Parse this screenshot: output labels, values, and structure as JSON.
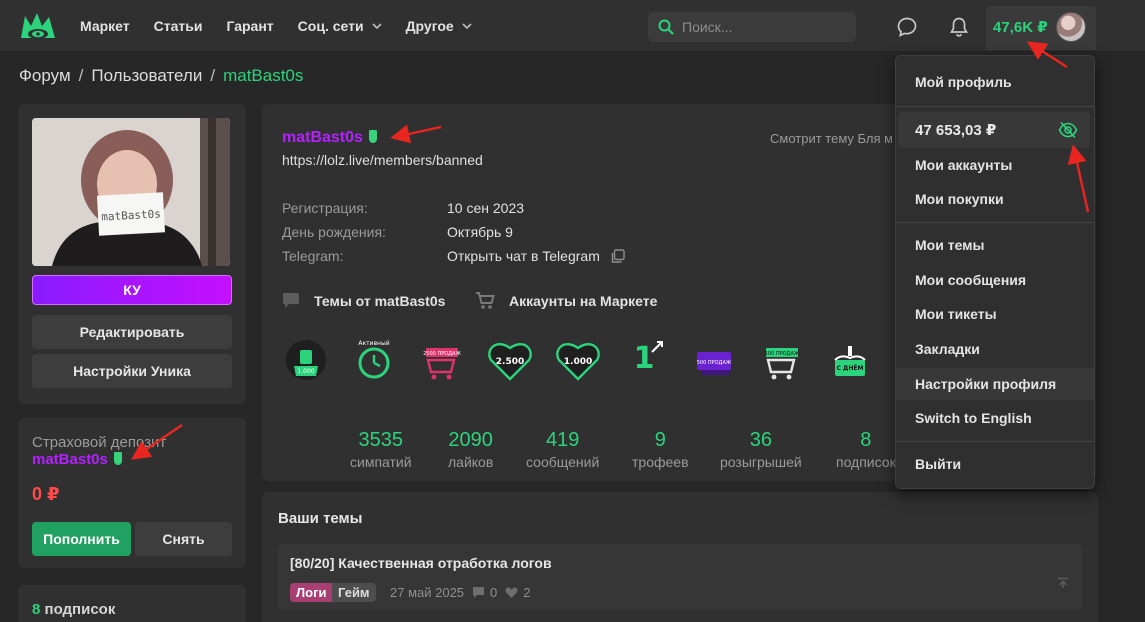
{
  "colors": {
    "accent": "#2bd37c",
    "username": "#b420ff",
    "danger": "#ff4b4b",
    "annotation": "#e8261f"
  },
  "nav": {
    "items": [
      {
        "label": "Маркет",
        "dropdown": false
      },
      {
        "label": "Статьи",
        "dropdown": false
      },
      {
        "label": "Гарант",
        "dropdown": false
      },
      {
        "label": "Соц. сети",
        "dropdown": true
      },
      {
        "label": "Другое",
        "dropdown": true
      }
    ],
    "search_placeholder": "Поиск...",
    "icons": [
      "logo-icon",
      "search-icon",
      "chat-icon",
      "bell-icon"
    ],
    "balance": "47,6K ₽"
  },
  "breadcrumb": {
    "items": [
      "Форум",
      "Пользователи"
    ],
    "current": "matBast0s",
    "separator": "/"
  },
  "left": {
    "photo_sign_text": "matBast0s",
    "ku_label": "КУ",
    "edit_label": "Редактировать",
    "unique_settings_label": "Настройки Уника",
    "deposit_title": "Страховой депозит",
    "deposit_user": "matBast0s",
    "deposit_amount": "0 ₽",
    "topup_label": "Пополнить",
    "withdraw_label": "Снять",
    "subs_count": "8",
    "subs_label": "подписок"
  },
  "profile": {
    "username": "matBast0s",
    "link": "https://lolz.live/members/banned",
    "watching": "Смотрит тему Бля м",
    "info": [
      {
        "label": "Регистрация:",
        "value": "10 сен 2023"
      },
      {
        "label": "День рождения:",
        "value": "Октябрь 9"
      },
      {
        "label": "Telegram:",
        "value": "Открыть чат в Telegram"
      }
    ],
    "topics_link": "Темы от matBast0s",
    "market_link": "Аккаунты на Маркете",
    "trophies": [
      {
        "name": "likes-1000-trophy",
        "text": "1.000"
      },
      {
        "name": "active-trophy",
        "text": "Активный"
      },
      {
        "name": "sales-2500-trophy",
        "text": "2500 ПРОДАЖ"
      },
      {
        "name": "sympathy-2500-trophy",
        "text": "2.500"
      },
      {
        "name": "sympathy-1000-trophy",
        "text": "1.000"
      },
      {
        "name": "year-on-forum-trophy",
        "text": "1"
      },
      {
        "name": "sales-500-trophy",
        "text": "500 ПРОДАЖ"
      },
      {
        "name": "sales-100-trophy",
        "text": "100 ПРОДАЖ"
      },
      {
        "name": "birthday-trophy",
        "text": "С ДНЁМ"
      }
    ],
    "stats": [
      {
        "value": "3535",
        "label": "симпатий"
      },
      {
        "value": "2090",
        "label": "лайков"
      },
      {
        "value": "419",
        "label": "сообщений"
      },
      {
        "value": "9",
        "label": "трофеев"
      },
      {
        "value": "36",
        "label": "розыгрышей"
      },
      {
        "value": "8",
        "label": "подписок"
      }
    ]
  },
  "topics": {
    "title": "Ваши темы",
    "items": [
      {
        "title": "[80/20] Качественная отработка логов",
        "tag_a": "Логи",
        "tag_b": "Гейм",
        "date": "27 май 2025",
        "replies": "0",
        "likes": "2"
      }
    ]
  },
  "dropdown": {
    "my_profile": "Мой профиль",
    "balance": "47 653,03 ₽",
    "my_accounts": "Мои аккаунты",
    "my_purchases": "Мои покупки",
    "my_topics": "Мои темы",
    "my_messages": "Мои сообщения",
    "my_tickets": "Мои тикеты",
    "bookmarks": "Закладки",
    "profile_settings": "Настройки профиля",
    "switch_lang": "Switch to English",
    "logout": "Выйти"
  }
}
